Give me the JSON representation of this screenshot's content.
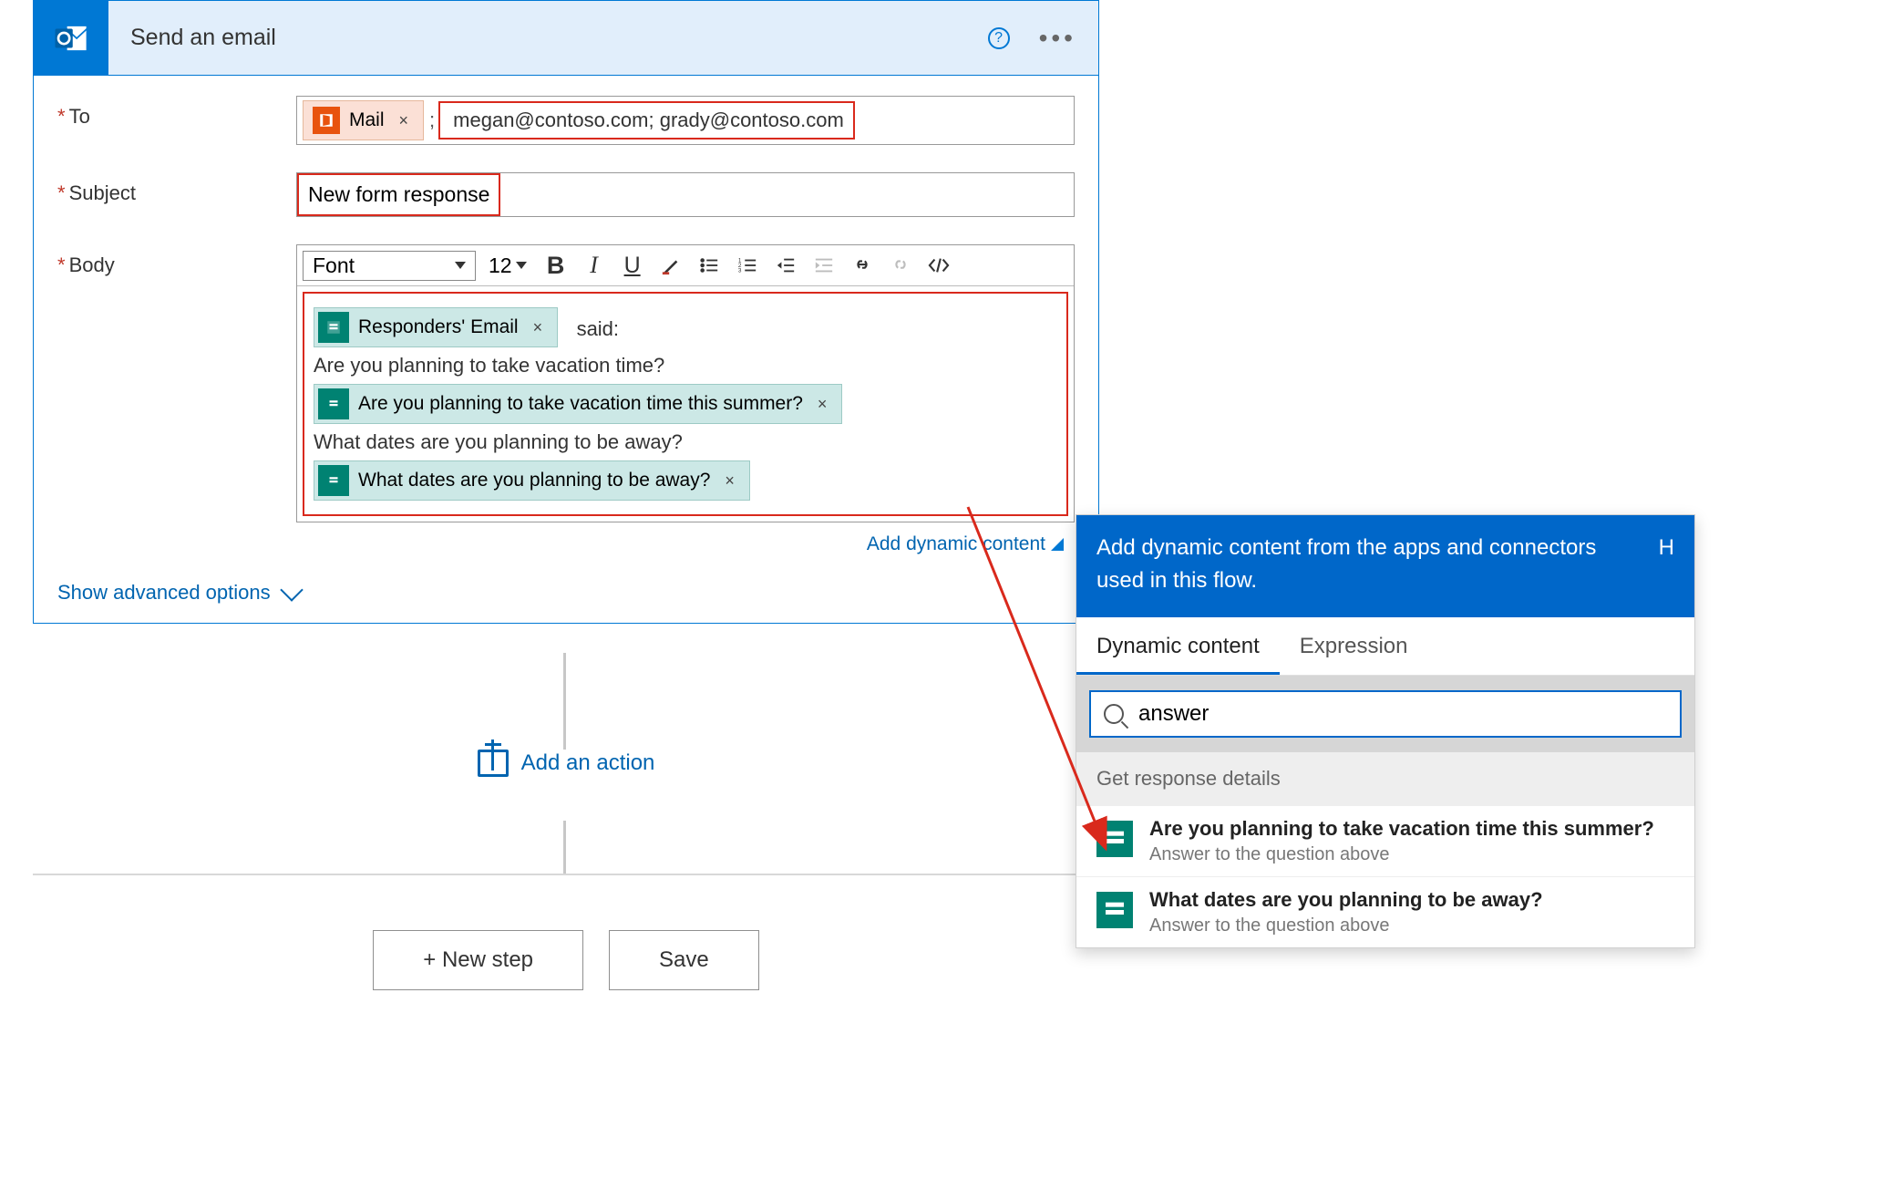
{
  "card": {
    "title": "Send an email",
    "fields": {
      "to_label": "To",
      "subject_label": "Subject",
      "body_label": "Body"
    },
    "to": {
      "chip": "Mail",
      "emails": "megan@contoso.com; grady@contoso.com"
    },
    "subject": "New form response",
    "editor": {
      "font_label": "Font",
      "size": "12"
    },
    "body": {
      "token1": "Responders' Email",
      "said": "said:",
      "q1_plain": "Are you planning to take vacation time?",
      "q1_token": "Are you planning to take vacation time this summer?",
      "q2_plain": "What dates are you planning to be away?",
      "q2_token": "What dates are you planning to be away?"
    },
    "add_dynamic": "Add dynamic content",
    "advanced": "Show advanced options"
  },
  "actions": {
    "add_action": "Add an action",
    "new_step": "+ New step",
    "save": "Save"
  },
  "dynamic_panel": {
    "header": "Add dynamic content from the apps and connectors used in this flow.",
    "hide": "H",
    "tab1": "Dynamic content",
    "tab2": "Expression",
    "search": "answer",
    "section": "Get response details",
    "results": [
      {
        "title": "Are you planning to take vacation time this summer?",
        "sub": "Answer to the question above"
      },
      {
        "title": "What dates are you planning to be away?",
        "sub": "Answer to the question above"
      }
    ]
  }
}
